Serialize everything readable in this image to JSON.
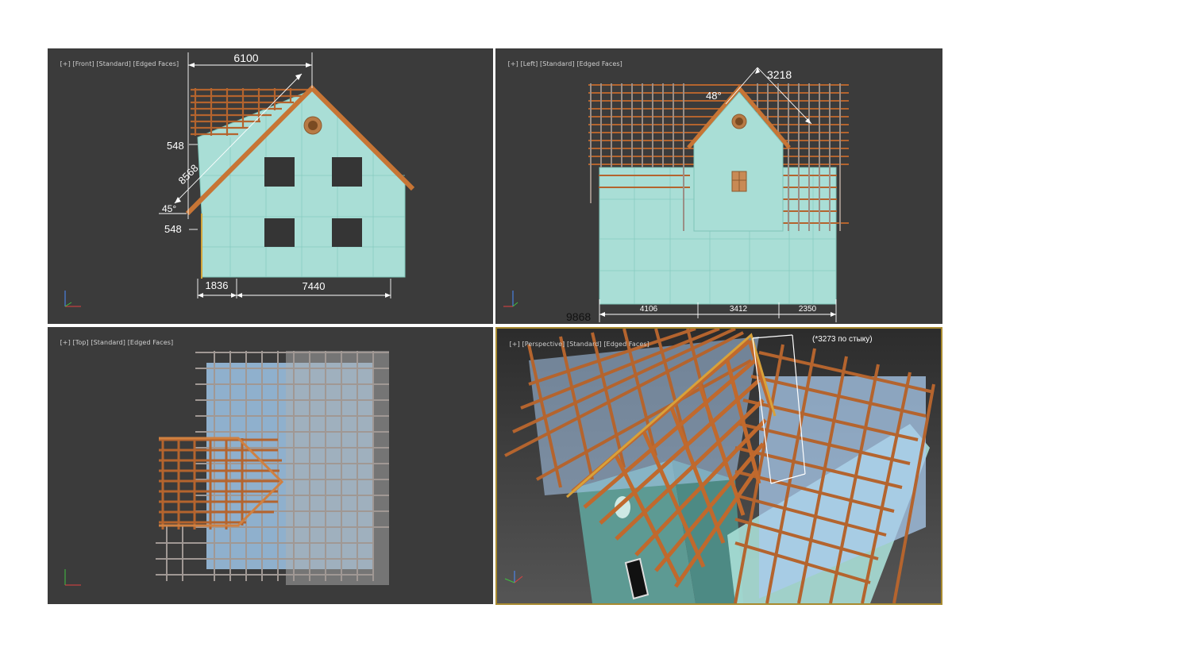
{
  "viewports": {
    "front": {
      "label_parts": [
        "[+]",
        "[Front]",
        "[Standard]",
        "[Edged Faces]"
      ],
      "dimensions": {
        "top_width": "6100",
        "eave_top": "548",
        "rafter_length": "8568",
        "angle": "45°",
        "eave_bottom": "548",
        "left_base": "1836",
        "right_base": "7440"
      }
    },
    "left": {
      "label_parts": [
        "[+]",
        "[Left]",
        "[Standard]",
        "[Edged Faces]"
      ],
      "dimensions": {
        "rafter_length": "3218",
        "angle": "48°",
        "seg1": "4106",
        "seg2": "3412",
        "seg3": "2350",
        "total": "9868"
      }
    },
    "top": {
      "label_parts": [
        "[+]",
        "[Top]",
        "[Standard]",
        "[Edged Faces]"
      ]
    },
    "perspective": {
      "label_parts": [
        "[+]",
        "[Perspective]",
        "[Standard]",
        "[Edged Faces]"
      ],
      "note": "(*3273 по стыку)"
    }
  },
  "colors": {
    "viewport_bg": "#3b3b3b",
    "wall": "#a9ded6",
    "timber": "#b4642e",
    "active_border": "#a88a2f"
  },
  "axis_icon": "xyz-axis-gizmo"
}
